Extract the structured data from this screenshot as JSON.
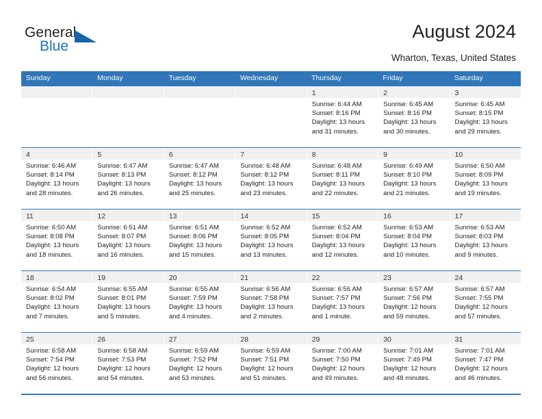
{
  "brand": {
    "name_part1": "General",
    "name_part2": "Blue",
    "flag_icon": "triangle-flag-icon",
    "accent_color": "#1565a8"
  },
  "header": {
    "title": "August 2024",
    "location": "Wharton, Texas, United States"
  },
  "calendar": {
    "header_color": "#3076b8",
    "day_band_color": "#f0f0f0",
    "weekdays": [
      "Sunday",
      "Monday",
      "Tuesday",
      "Wednesday",
      "Thursday",
      "Friday",
      "Saturday"
    ],
    "weeks": [
      [
        {
          "day": "",
          "lines": []
        },
        {
          "day": "",
          "lines": []
        },
        {
          "day": "",
          "lines": []
        },
        {
          "day": "",
          "lines": []
        },
        {
          "day": "1",
          "lines": [
            "Sunrise: 6:44 AM",
            "Sunset: 8:16 PM",
            "Daylight: 13 hours",
            "and 31 minutes."
          ]
        },
        {
          "day": "2",
          "lines": [
            "Sunrise: 6:45 AM",
            "Sunset: 8:16 PM",
            "Daylight: 13 hours",
            "and 30 minutes."
          ]
        },
        {
          "day": "3",
          "lines": [
            "Sunrise: 6:45 AM",
            "Sunset: 8:15 PM",
            "Daylight: 13 hours",
            "and 29 minutes."
          ]
        }
      ],
      [
        {
          "day": "4",
          "lines": [
            "Sunrise: 6:46 AM",
            "Sunset: 8:14 PM",
            "Daylight: 13 hours",
            "and 28 minutes."
          ]
        },
        {
          "day": "5",
          "lines": [
            "Sunrise: 6:47 AM",
            "Sunset: 8:13 PM",
            "Daylight: 13 hours",
            "and 26 minutes."
          ]
        },
        {
          "day": "6",
          "lines": [
            "Sunrise: 6:47 AM",
            "Sunset: 8:12 PM",
            "Daylight: 13 hours",
            "and 25 minutes."
          ]
        },
        {
          "day": "7",
          "lines": [
            "Sunrise: 6:48 AM",
            "Sunset: 8:12 PM",
            "Daylight: 13 hours",
            "and 23 minutes."
          ]
        },
        {
          "day": "8",
          "lines": [
            "Sunrise: 6:48 AM",
            "Sunset: 8:11 PM",
            "Daylight: 13 hours",
            "and 22 minutes."
          ]
        },
        {
          "day": "9",
          "lines": [
            "Sunrise: 6:49 AM",
            "Sunset: 8:10 PM",
            "Daylight: 13 hours",
            "and 21 minutes."
          ]
        },
        {
          "day": "10",
          "lines": [
            "Sunrise: 6:50 AM",
            "Sunset: 8:09 PM",
            "Daylight: 13 hours",
            "and 19 minutes."
          ]
        }
      ],
      [
        {
          "day": "11",
          "lines": [
            "Sunrise: 6:50 AM",
            "Sunset: 8:08 PM",
            "Daylight: 13 hours",
            "and 18 minutes."
          ]
        },
        {
          "day": "12",
          "lines": [
            "Sunrise: 6:51 AM",
            "Sunset: 8:07 PM",
            "Daylight: 13 hours",
            "and 16 minutes."
          ]
        },
        {
          "day": "13",
          "lines": [
            "Sunrise: 6:51 AM",
            "Sunset: 8:06 PM",
            "Daylight: 13 hours",
            "and 15 minutes."
          ]
        },
        {
          "day": "14",
          "lines": [
            "Sunrise: 6:52 AM",
            "Sunset: 8:05 PM",
            "Daylight: 13 hours",
            "and 13 minutes."
          ]
        },
        {
          "day": "15",
          "lines": [
            "Sunrise: 6:52 AM",
            "Sunset: 8:04 PM",
            "Daylight: 13 hours",
            "and 12 minutes."
          ]
        },
        {
          "day": "16",
          "lines": [
            "Sunrise: 6:53 AM",
            "Sunset: 8:04 PM",
            "Daylight: 13 hours",
            "and 10 minutes."
          ]
        },
        {
          "day": "17",
          "lines": [
            "Sunrise: 6:53 AM",
            "Sunset: 8:03 PM",
            "Daylight: 13 hours",
            "and 9 minutes."
          ]
        }
      ],
      [
        {
          "day": "18",
          "lines": [
            "Sunrise: 6:54 AM",
            "Sunset: 8:02 PM",
            "Daylight: 13 hours",
            "and 7 minutes."
          ]
        },
        {
          "day": "19",
          "lines": [
            "Sunrise: 6:55 AM",
            "Sunset: 8:01 PM",
            "Daylight: 13 hours",
            "and 5 minutes."
          ]
        },
        {
          "day": "20",
          "lines": [
            "Sunrise: 6:55 AM",
            "Sunset: 7:59 PM",
            "Daylight: 13 hours",
            "and 4 minutes."
          ]
        },
        {
          "day": "21",
          "lines": [
            "Sunrise: 6:56 AM",
            "Sunset: 7:58 PM",
            "Daylight: 13 hours",
            "and 2 minutes."
          ]
        },
        {
          "day": "22",
          "lines": [
            "Sunrise: 6:56 AM",
            "Sunset: 7:57 PM",
            "Daylight: 13 hours",
            "and 1 minute."
          ]
        },
        {
          "day": "23",
          "lines": [
            "Sunrise: 6:57 AM",
            "Sunset: 7:56 PM",
            "Daylight: 12 hours",
            "and 59 minutes."
          ]
        },
        {
          "day": "24",
          "lines": [
            "Sunrise: 6:57 AM",
            "Sunset: 7:55 PM",
            "Daylight: 12 hours",
            "and 57 minutes."
          ]
        }
      ],
      [
        {
          "day": "25",
          "lines": [
            "Sunrise: 6:58 AM",
            "Sunset: 7:54 PM",
            "Daylight: 12 hours",
            "and 56 minutes."
          ]
        },
        {
          "day": "26",
          "lines": [
            "Sunrise: 6:58 AM",
            "Sunset: 7:53 PM",
            "Daylight: 12 hours",
            "and 54 minutes."
          ]
        },
        {
          "day": "27",
          "lines": [
            "Sunrise: 6:59 AM",
            "Sunset: 7:52 PM",
            "Daylight: 12 hours",
            "and 53 minutes."
          ]
        },
        {
          "day": "28",
          "lines": [
            "Sunrise: 6:59 AM",
            "Sunset: 7:51 PM",
            "Daylight: 12 hours",
            "and 51 minutes."
          ]
        },
        {
          "day": "29",
          "lines": [
            "Sunrise: 7:00 AM",
            "Sunset: 7:50 PM",
            "Daylight: 12 hours",
            "and 49 minutes."
          ]
        },
        {
          "day": "30",
          "lines": [
            "Sunrise: 7:01 AM",
            "Sunset: 7:49 PM",
            "Daylight: 12 hours",
            "and 48 minutes."
          ]
        },
        {
          "day": "31",
          "lines": [
            "Sunrise: 7:01 AM",
            "Sunset: 7:47 PM",
            "Daylight: 12 hours",
            "and 46 minutes."
          ]
        }
      ]
    ]
  }
}
